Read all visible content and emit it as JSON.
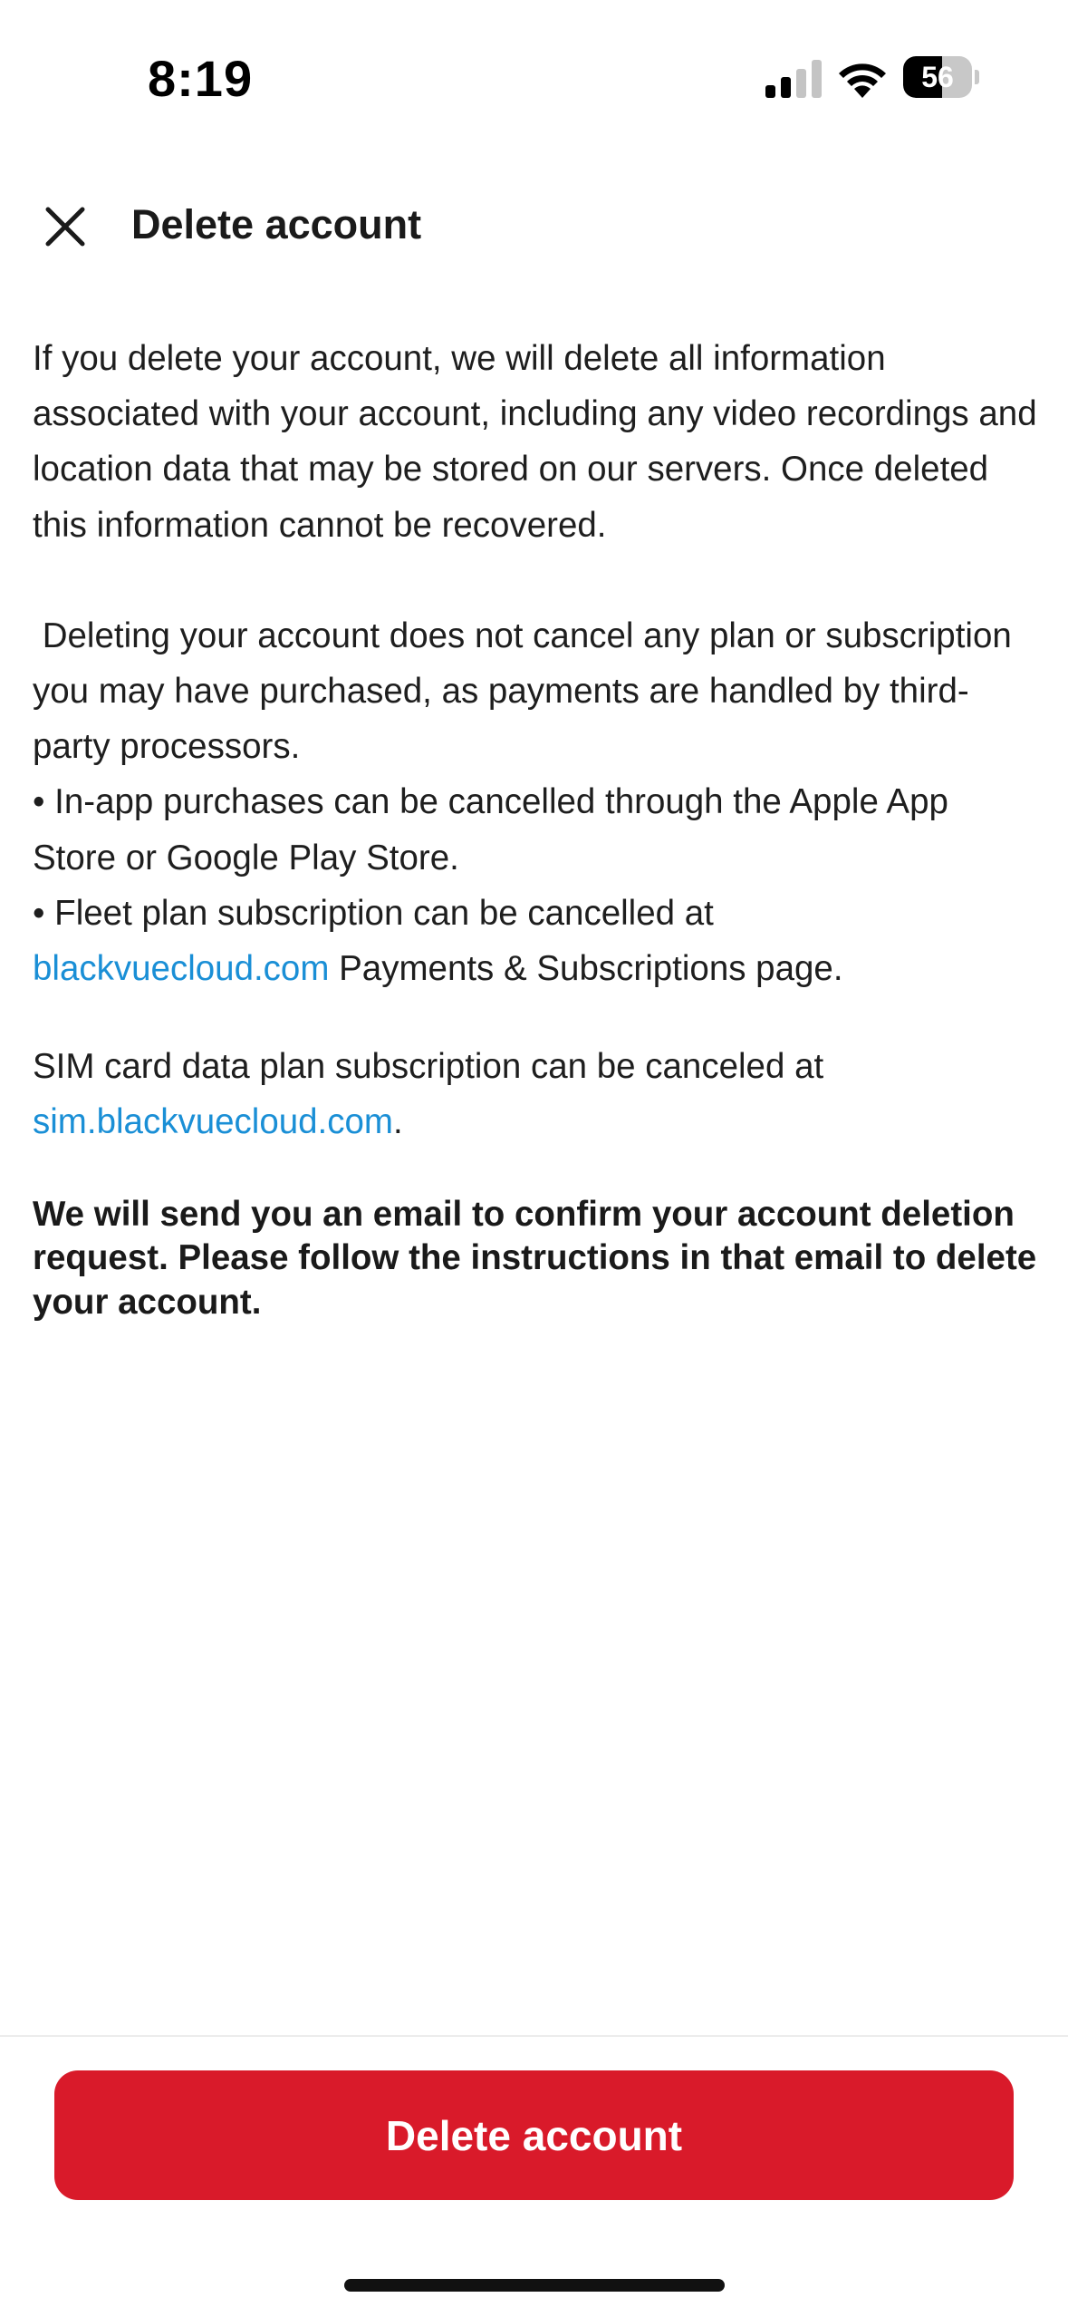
{
  "status_bar": {
    "time": "8:19",
    "battery_level": "56",
    "battery_fraction": 0.56,
    "icons": [
      "signal-icon",
      "wifi-icon",
      "battery-icon"
    ]
  },
  "header": {
    "title": "Delete account",
    "close_icon": "close-icon"
  },
  "content": {
    "p1": "If you delete your account, we will delete all information associated with your account, including any video recordings and location data that may be stored on our servers. Once deleted this information cannot be recovered.",
    "p2": " Deleting your account does not cancel any plan or subscription you may have purchased, as payments are handled by third-party processors.",
    "bullet1": "• In-app purchases can be cancelled through the Apple App Store or Google Play Store.",
    "bullet2_prefix": "• Fleet plan subscription can be cancelled at",
    "bullet2_link": "blackvuecloud.com",
    "bullet2_suffix": " Payments & Subscriptions page.",
    "sim_prefix": "SIM card data plan subscription can be canceled at",
    "sim_link": "sim.blackvuecloud.com",
    "sim_suffix": ".",
    "confirm_note": "We will send you an email to confirm your account deletion request. Please follow the instructions in that email to delete your account."
  },
  "footer": {
    "delete_button_label": "Delete account"
  },
  "colors": {
    "accent_red": "#d91a2a",
    "link_blue": "#1a8fd6",
    "text": "#1e1e1e"
  }
}
